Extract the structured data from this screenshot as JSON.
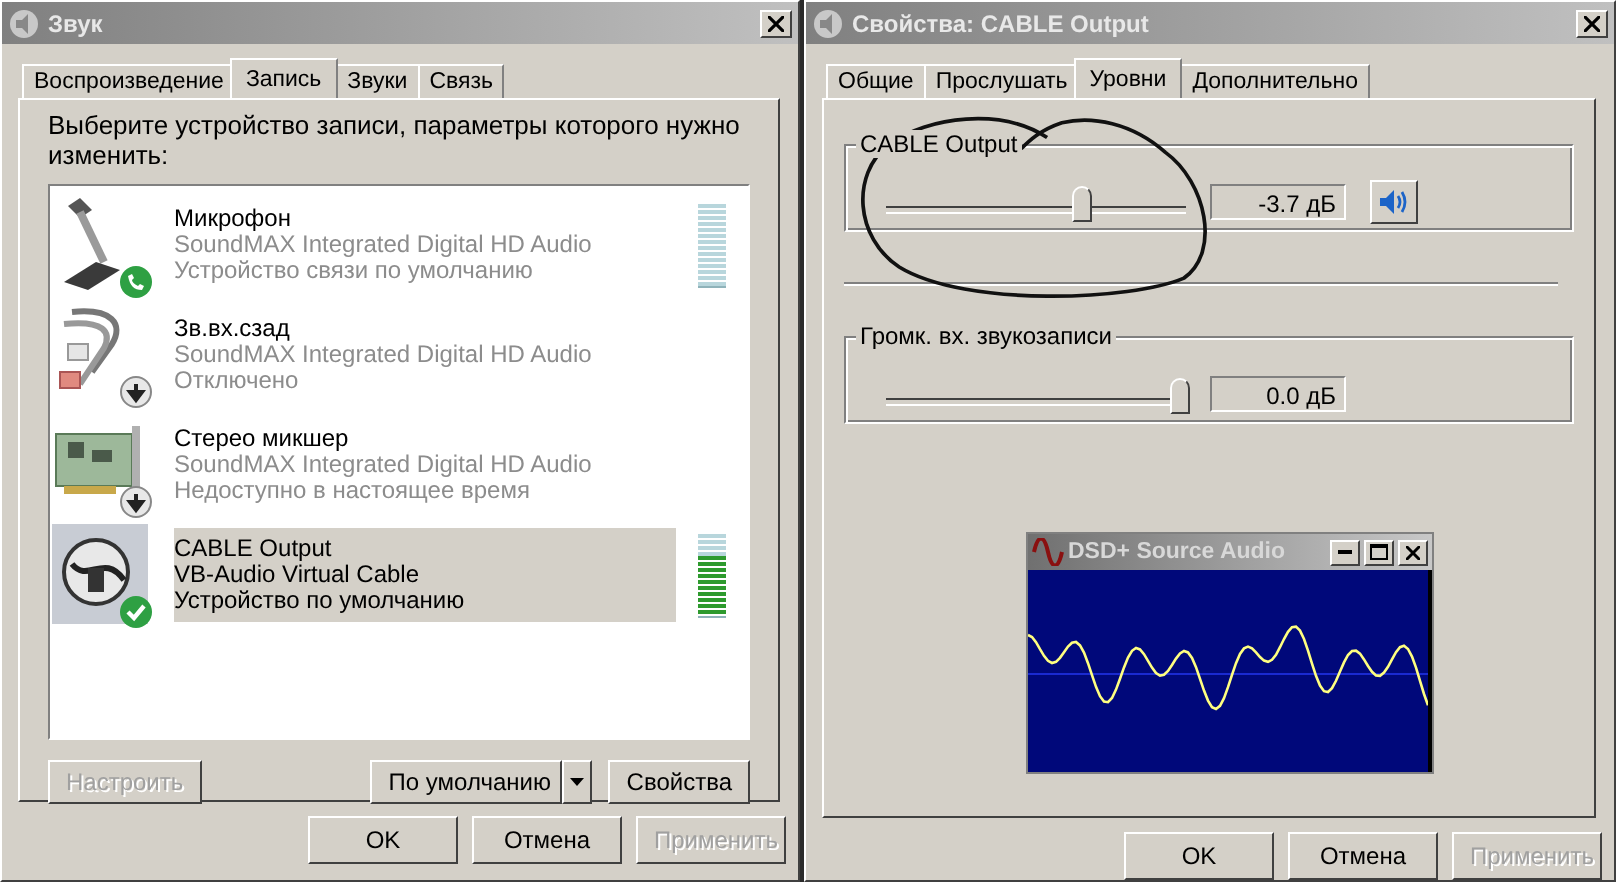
{
  "sound_window": {
    "title": "Звук",
    "tabs": [
      {
        "label": "Воспроизведение",
        "selected": false
      },
      {
        "label": "Запись",
        "selected": true
      },
      {
        "label": "Звуки",
        "selected": false
      },
      {
        "label": "Связь",
        "selected": false
      }
    ],
    "instruction": "Выберите устройство записи, параметры которого нужно изменить:",
    "devices": [
      {
        "kind": "microphone",
        "badge": {
          "kind": "phone"
        },
        "name": "Микрофон",
        "driver": "SoundMAX Integrated Digital HD Audio",
        "status": "Устройство связи по умолчанию",
        "selected": false,
        "level": 0
      },
      {
        "kind": "rca-cable",
        "badge": {
          "kind": "down-arrow"
        },
        "name": "Зв.вх.сзад",
        "driver": "SoundMAX Integrated Digital HD Audio",
        "status": "Отключено",
        "selected": false
      },
      {
        "kind": "sound-card",
        "badge": {
          "kind": "down-arrow"
        },
        "name": "Стерео микшер",
        "driver": "SoundMAX Integrated Digital HD Audio",
        "status": "Недоступно в настоящее время",
        "selected": false
      },
      {
        "kind": "cable",
        "badge": {
          "kind": "check"
        },
        "name": "CABLE Output",
        "driver": "VB-Audio Virtual Cable",
        "status": "Устройство по умолчанию",
        "selected": true,
        "level": 0.7
      }
    ],
    "configure_button": {
      "label": "Настроить",
      "disabled": true
    },
    "default_button": {
      "label": "По умолчанию",
      "disabled": false
    },
    "properties_button": {
      "label": "Свойства",
      "disabled": false
    },
    "dialog_buttons": [
      {
        "label": "OK",
        "disabled": false
      },
      {
        "label": "Отмена",
        "disabled": false
      },
      {
        "label": "Применить",
        "disabled": true
      }
    ]
  },
  "properties_window": {
    "title": "Свойства: CABLE Output",
    "tabs": [
      {
        "label": "Общие",
        "selected": false
      },
      {
        "label": "Прослушать",
        "selected": false
      },
      {
        "label": "Уровни",
        "selected": true
      },
      {
        "label": "Дополнительно",
        "selected": false
      }
    ],
    "levels": [
      {
        "kind": "mute",
        "label": "CABLE Output",
        "level": 0.65,
        "reading": "-3.7 дБ"
      },
      {
        "kind": "plain",
        "label": "Громк. вх. звукозаписи",
        "level": 0.98,
        "reading": "0.0 дБ"
      }
    ],
    "dialog_buttons": [
      {
        "label": "OK",
        "disabled": false
      },
      {
        "label": "Отмена",
        "disabled": false
      },
      {
        "label": "Применить",
        "disabled": true
      }
    ]
  },
  "scope_window": {
    "title": "DSD+ Source Audio"
  }
}
